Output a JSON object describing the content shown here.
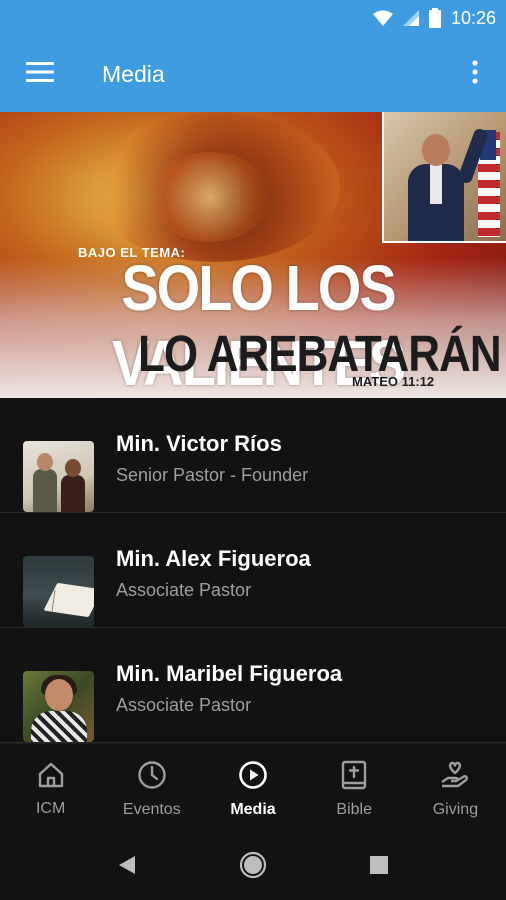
{
  "status_bar": {
    "time": "10:26",
    "icons": [
      "wifi-icon",
      "signal-icon",
      "battery-icon"
    ]
  },
  "app_bar": {
    "title": "Media",
    "menu_icon": "hamburger-menu-icon",
    "overflow_icon": "more-vertical-icon",
    "background_color": "#3f9ce0"
  },
  "banner": {
    "subtitle": "BAJO EL TEMA:",
    "title": "SOLO LOS VALIENTES",
    "title_line2": "LO AREBATARÁN",
    "verse": "MATEO 11:12"
  },
  "list": {
    "items": [
      {
        "name": "Min. Victor Ríos",
        "role": "Senior Pastor - Founder"
      },
      {
        "name": "Min. Alex Figueroa",
        "role": "Associate Pastor"
      },
      {
        "name": "Min. Maribel Figueroa",
        "role": "Associate Pastor"
      }
    ]
  },
  "bottom_nav": {
    "items": [
      {
        "label": "ICM",
        "icon": "home-icon",
        "active": false
      },
      {
        "label": "Eventos",
        "icon": "clock-icon",
        "active": false
      },
      {
        "label": "Media",
        "icon": "play-circle-icon",
        "active": true
      },
      {
        "label": "Bible",
        "icon": "bible-icon",
        "active": false
      },
      {
        "label": "Giving",
        "icon": "giving-hand-icon",
        "active": false
      }
    ]
  },
  "system_nav": {
    "icons": [
      "back-icon",
      "home-circle-icon",
      "recents-icon"
    ]
  },
  "colors": {
    "primary": "#3f9ce0",
    "background": "#121212",
    "text_secondary": "#9e9e9e"
  }
}
